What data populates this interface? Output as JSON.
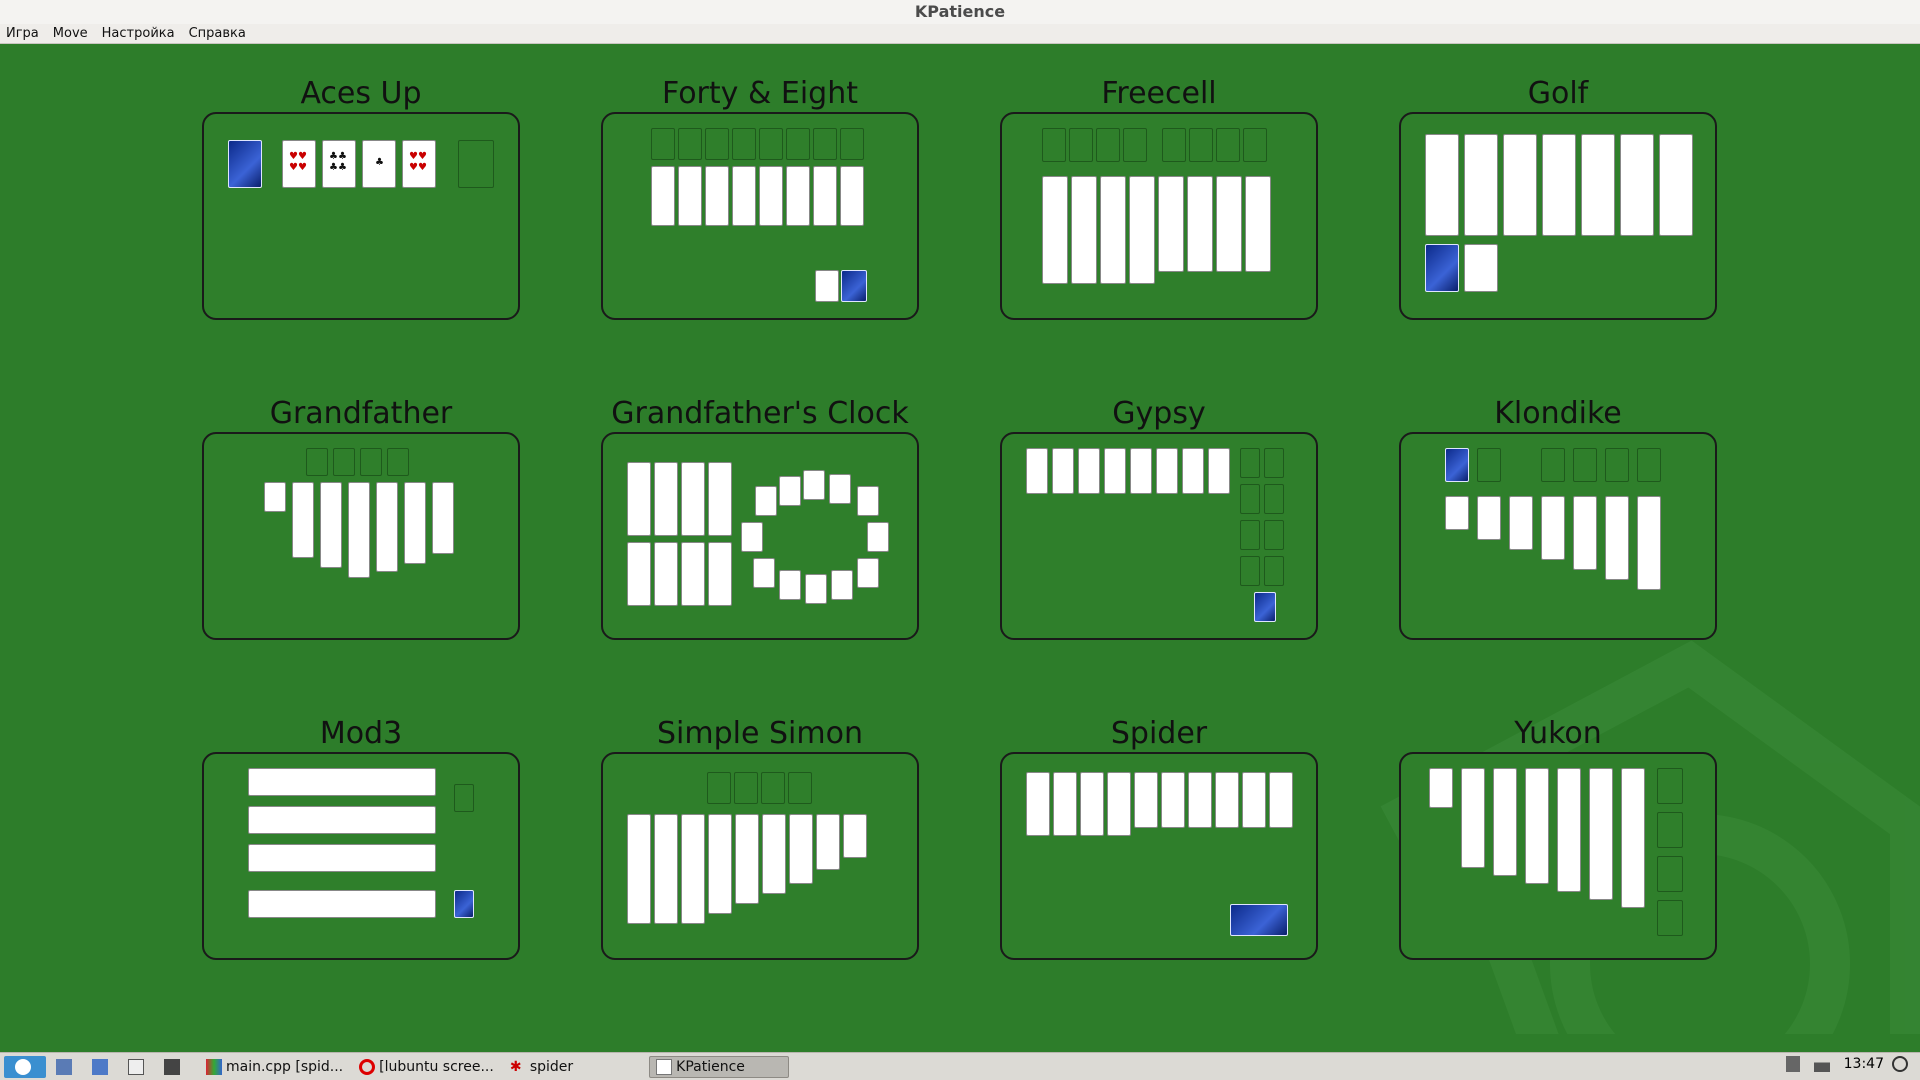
{
  "window": {
    "title": "KPatience"
  },
  "menu": [
    "Игра",
    "Move",
    "Настройка",
    "Справка"
  ],
  "games": [
    {
      "name": "Aces Up"
    },
    {
      "name": "Forty & Eight"
    },
    {
      "name": "Freecell"
    },
    {
      "name": "Golf"
    },
    {
      "name": "Grandfather"
    },
    {
      "name": "Grandfather's Clock"
    },
    {
      "name": "Gypsy"
    },
    {
      "name": "Klondike"
    },
    {
      "name": "Mod3"
    },
    {
      "name": "Simple Simon"
    },
    {
      "name": "Spider"
    },
    {
      "name": "Yukon"
    }
  ],
  "taskbar": {
    "items": [
      "main.cpp [spid...",
      "[lubuntu scree...",
      "spider",
      "KPatience"
    ],
    "clock": "13:47"
  },
  "colors": {
    "felt": "#2d7d2a",
    "card_back": "#1f48c2",
    "red_suit": "#c90000"
  },
  "icons": [
    "lubuntu-menu-icon",
    "show-desktop-icon",
    "file-manager-icon",
    "window-icon",
    "terminal-icon",
    "kate-icon",
    "opera-icon",
    "spider-icon",
    "kpatience-icon",
    "clipboard-icon",
    "network-icon",
    "power-icon"
  ]
}
